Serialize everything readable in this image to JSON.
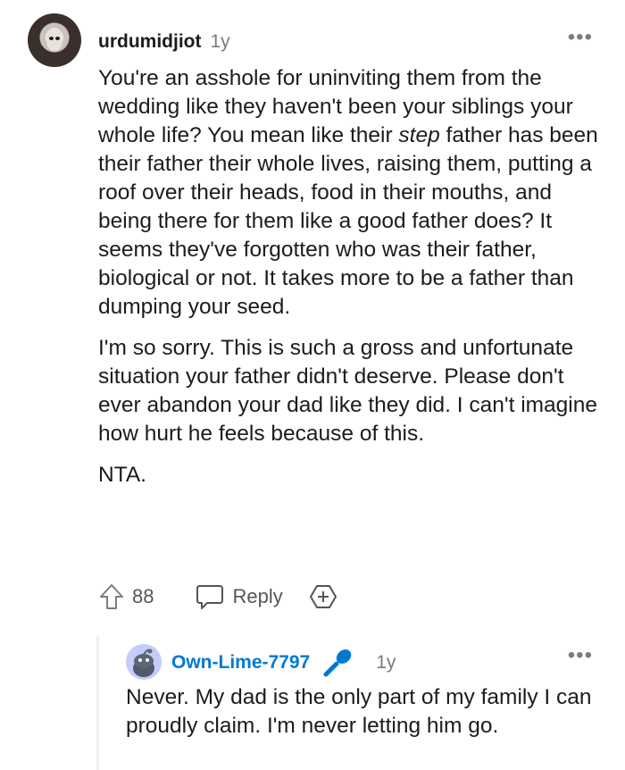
{
  "comment": {
    "username": "urdumidjiot",
    "age": "1y",
    "paragraphs": [
      "You're an asshole for uninviting them from the wedding like they haven't been your siblings your whole life? You mean like their step father has been their father their whole lives, raising them, putting a roof over their heads, food in their mouths, and being there for them like a good father does? It seems they've forgotten who was their father, biological or not. It takes more to be a father than dumping your seed.",
      "I'm so sorry. This is such a gross and unfortunate situation your father didn't deserve. Please don't ever abandon your dad like they did. I can't imagine how hurt he feels because of this.",
      "NTA."
    ],
    "score": "88",
    "reply_label": "Reply",
    "more_label": "•••"
  },
  "reply": {
    "username": "Own-Lime-7797",
    "age": "1y",
    "text": "Never. My dad is the only part of my family I can proudly claim. I'm never letting him go.",
    "more_label": "•••"
  },
  "colors": {
    "username_link": "#0079d3",
    "muted": "#7c7c7c",
    "text": "#1c1c1c"
  },
  "icons": [
    "upvote-icon",
    "comment-bubble-icon",
    "award-plus-icon",
    "snoo-avatar-icon",
    "microphone-flair-icon"
  ]
}
